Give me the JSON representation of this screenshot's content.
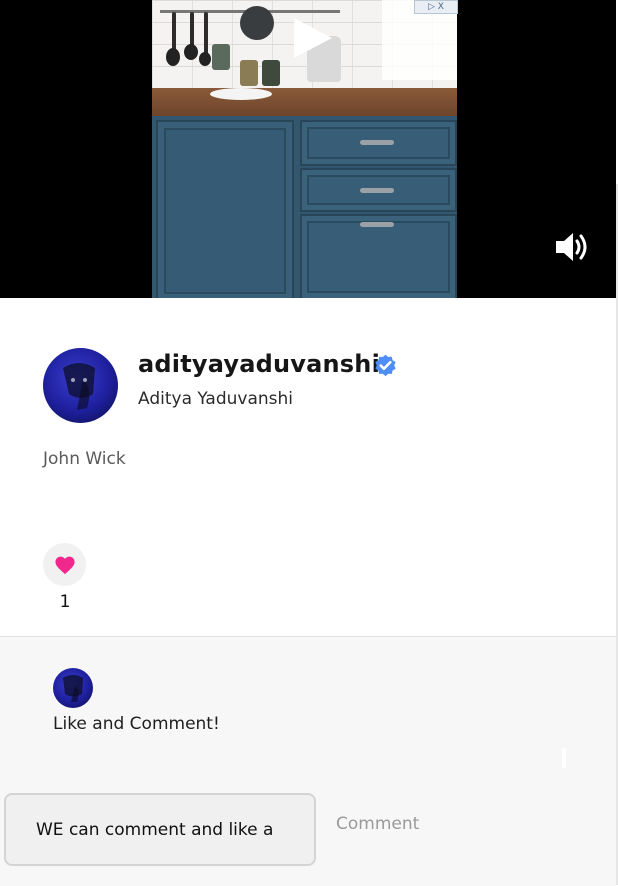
{
  "video": {
    "ad_badge": "▷ X",
    "play_icon": "play-icon",
    "volume_icon": "volume-icon"
  },
  "post": {
    "username": "adityayaduvanshi",
    "full_name": "Aditya Yaduvanshi",
    "verified": true,
    "caption": "John Wick",
    "like_count": "1",
    "colors": {
      "verified": "#4f8ef7",
      "heart": "#f0288c",
      "comment_button": "#9a9a9a"
    }
  },
  "comments": {
    "items": [
      {
        "text": "Like and Comment!"
      }
    ],
    "input_value": "WE can comment and like a",
    "submit_label": "Comment"
  }
}
